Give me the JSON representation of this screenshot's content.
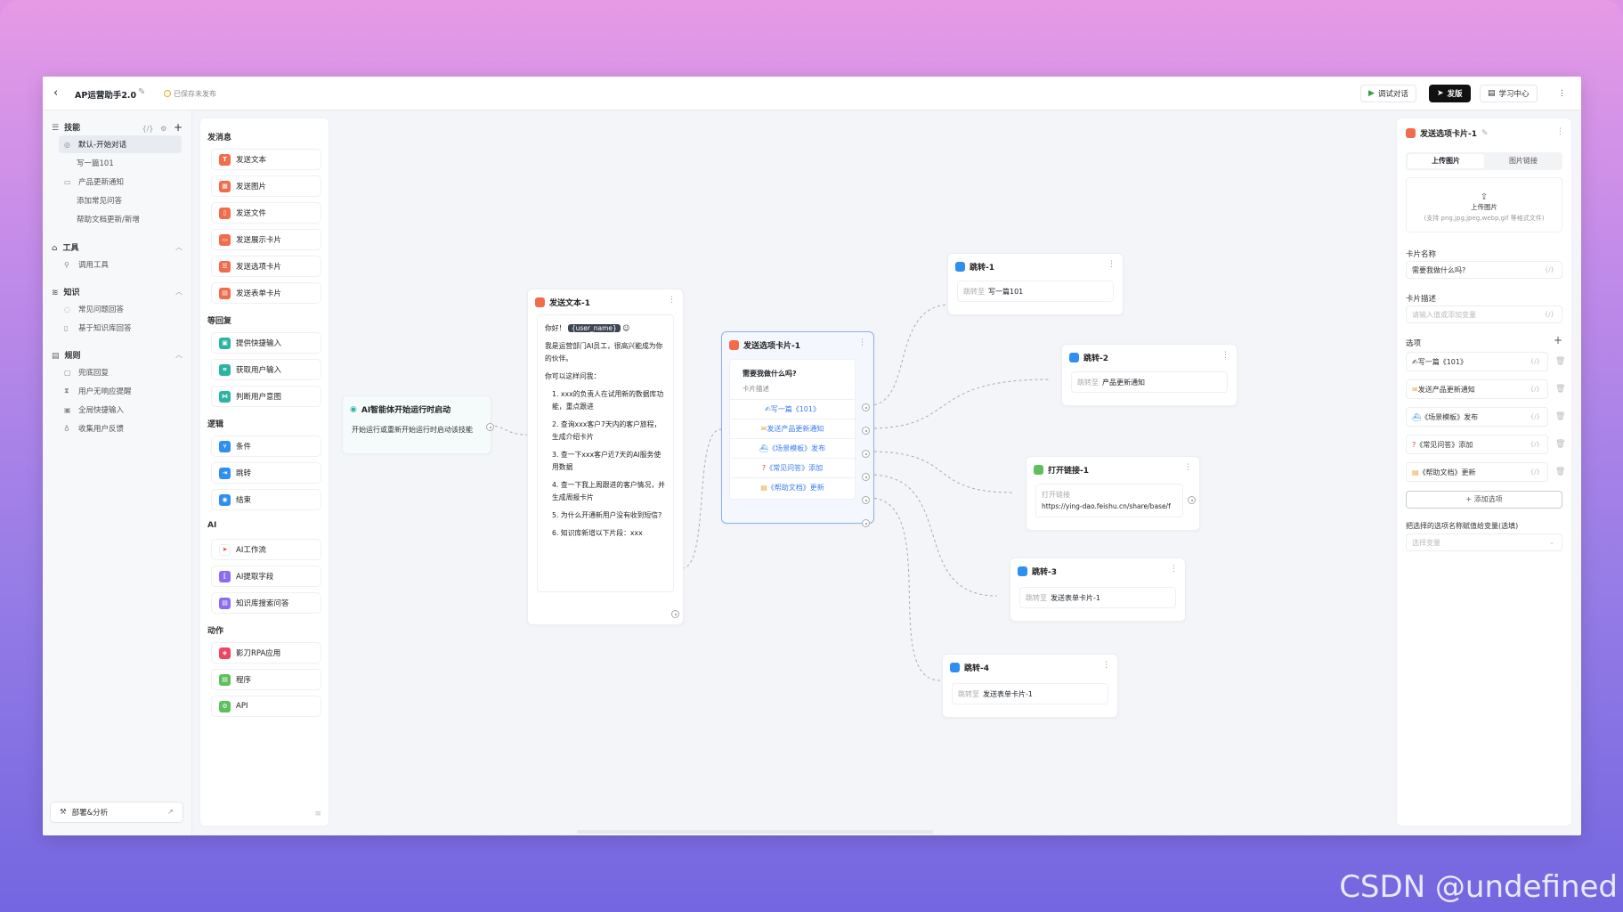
{
  "header": {
    "title": "AP运营助手2.0",
    "status": "已保存未发布",
    "debug_label": "调试对话",
    "publish_label": "发版",
    "learn_label": "学习中心"
  },
  "sidebar": {
    "skills_label": "技能",
    "skills_code": "{/}",
    "skills": [
      "默认-开始对话",
      "写一篇101",
      "产品更新通知",
      "添加常见问答",
      "帮助文档更新/新增"
    ],
    "tools_label": "工具",
    "tools": [
      "调用工具"
    ],
    "knowledge_label": "知识",
    "knowledge": [
      "常见问题回答",
      "基于知识库回答"
    ],
    "rules_label": "规则",
    "rules": [
      "兜底回复",
      "用户无响应提醒",
      "全局快捷输入",
      "收集用户反馈"
    ],
    "deploy_label": "部署&分析"
  },
  "palette": {
    "send_cat": "发消息",
    "send": [
      "发送文本",
      "发送图片",
      "发送文件",
      "发送展示卡片",
      "发送选项卡片",
      "发送表单卡片"
    ],
    "wait_cat": "等回复",
    "wait": [
      "提供快捷输入",
      "获取用户输入",
      "判断用户意图"
    ],
    "logic_cat": "逻辑",
    "logic": [
      "条件",
      "跳转",
      "结束"
    ],
    "ai_cat": "AI",
    "ai": [
      "AI工作流",
      "AI提取字段",
      "知识库搜索问答"
    ],
    "action_cat": "动作",
    "action": [
      "影刀RPA应用",
      "程序",
      "API"
    ]
  },
  "canvas": {
    "start": {
      "title": "AI智能体开始运行时启动",
      "desc": "开始运行或重新开始运行时启动该技能"
    },
    "text_node": {
      "title": "发送文本-1",
      "greeting": "你好！",
      "var": "{user_name}",
      "intro": "我是运营部门AI员工，很高兴能成为你的伙伴。",
      "prompt": "你可以这样问我：",
      "items": [
        "1. xxx的负责人在试用新的数据库功能，重点跟进",
        "2. 查询xxx客户7天内的客户旅程，生成介绍卡片",
        "3. 查一下xxx客户近7天的AI服务使用数据",
        "4. 查一下我上周跟进的客户情况，并生成周报卡片",
        "5. 为什么开通新用户没有收到短信?",
        "6. 知识库新增以下片段：xxx"
      ]
    },
    "option_node": {
      "title": "发送选项卡片-1",
      "question": "需要我做什么吗?",
      "desc": "卡片描述",
      "options": [
        "写一篇《101》",
        "发送产品更新通知",
        "《场景模板》发布",
        "《常见问答》添加",
        "《帮助文档》更新"
      ]
    },
    "jump1": {
      "title": "跳转-1",
      "label": "跳转至",
      "target": "写一篇101"
    },
    "jump2": {
      "title": "跳转-2",
      "label": "跳转至",
      "target": "产品更新通知"
    },
    "link1": {
      "title": "打开链接-1",
      "label": "打开链接",
      "url": "https://ying-dao.feishu.cn/share/base/f"
    },
    "jump3": {
      "title": "跳转-3",
      "label": "跳转至",
      "target": "发送表单卡片-1"
    },
    "jump4": {
      "title": "跳转-4",
      "label": "跳转至",
      "target": "发送表单卡片-1"
    }
  },
  "panel": {
    "title": "发送选项卡片-1",
    "tab_upload": "上传图片",
    "tab_link": "图片链接",
    "upload_label": "上传图片",
    "upload_hint": "(支持 png,jpg,jpeg,webp,gif 等格式文件)",
    "name_label": "卡片名称",
    "name_value": "需要我做什么吗?",
    "desc_label": "卡片描述",
    "desc_placeholder": "请输入值或添加变量",
    "var_code": "{/}",
    "options_label": "选项",
    "options": [
      "写一篇《101》",
      "发送产品更新通知",
      "《场景模板》发布",
      "《常见问答》添加",
      "《帮助文档》更新"
    ],
    "add_option": "+ 添加选项",
    "assign_label": "把选择的选项名称赋值给变量(选填)",
    "assign_placeholder": "选择变量"
  },
  "watermark": "CSDN @undefined",
  "colors": {
    "send": "#f26b4b",
    "wait": "#2bb3a3",
    "logic": "#2f8ff0",
    "ai": "#8b6cf0",
    "action": "#5cc05c",
    "link": "#3b7cf0"
  }
}
